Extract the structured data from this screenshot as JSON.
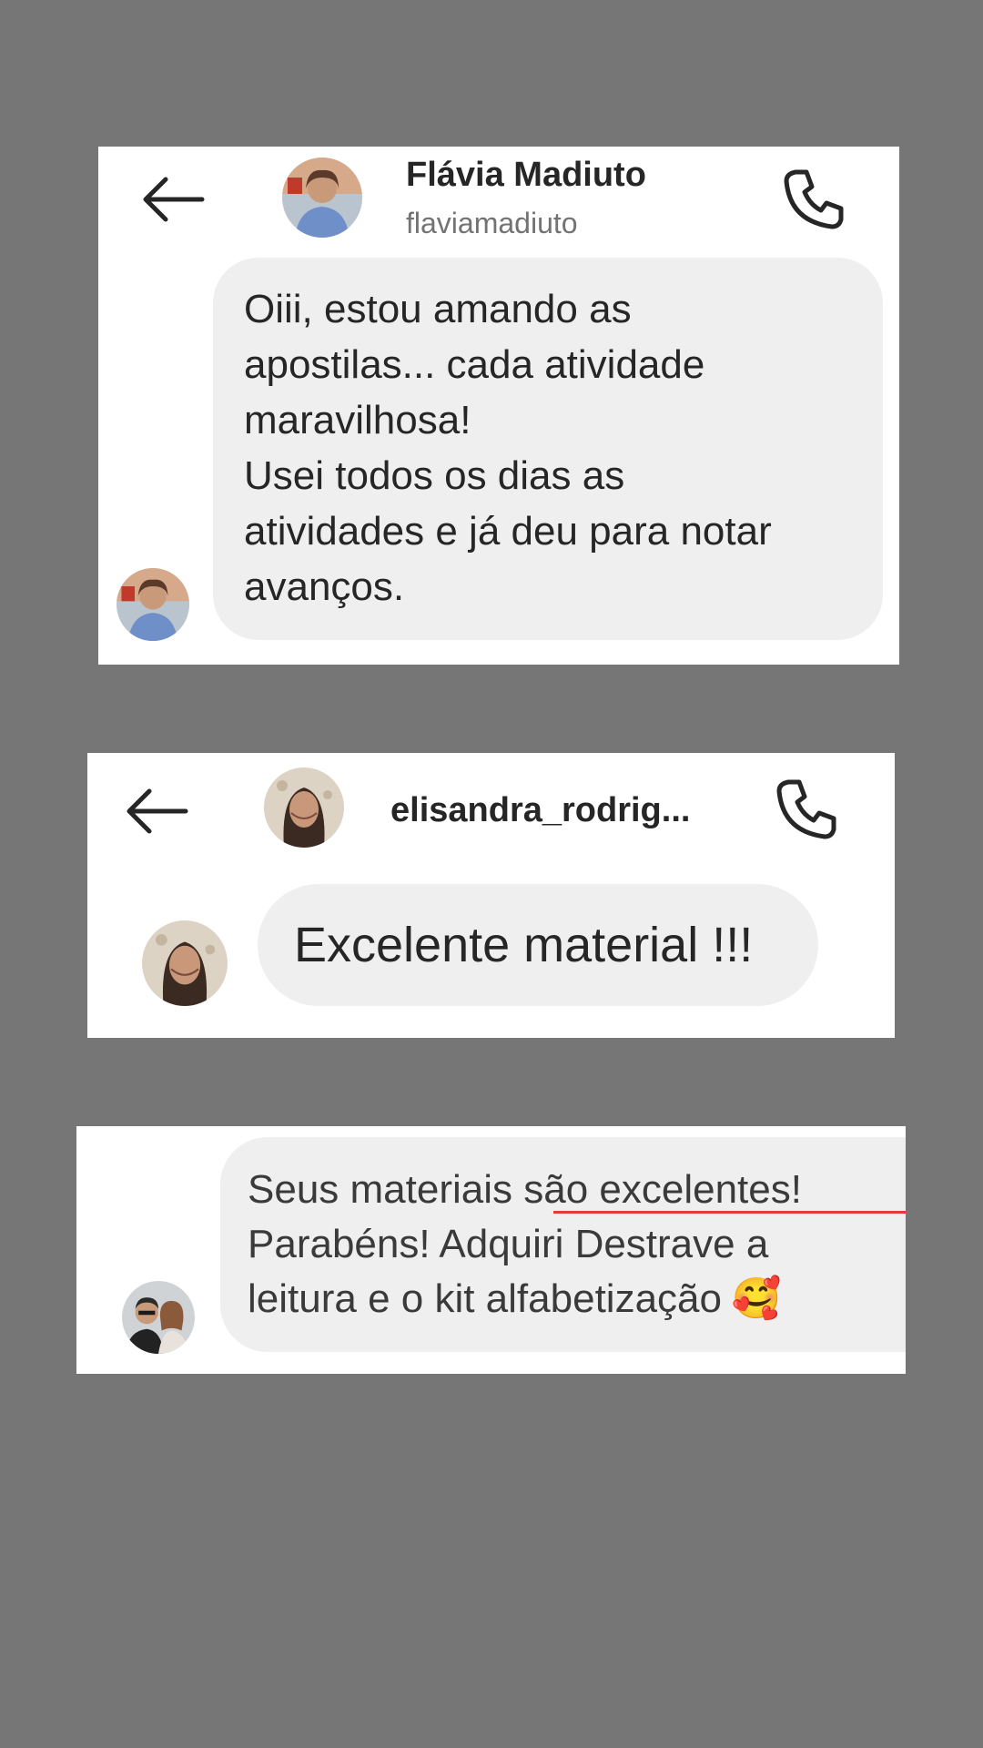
{
  "conversations": [
    {
      "contact_name": "Flávia Madiuto",
      "contact_handle": "flaviamadiuto",
      "message": "Oiii, estou amando as\napostilas... cada atividade\nmaravilhosa!\nUsei todos os dias as\natividades e já  deu para notar\navanços."
    },
    {
      "contact_name": "elisandra_rodrig...",
      "message": "Excelente material !!!"
    },
    {
      "message": "Seus materiais são excelentes!\nParabéns! Adquiri Destrave a\nleitura e o kit alfabetização",
      "emoji": "🥰"
    }
  ],
  "icons": {
    "back": "back-arrow-icon",
    "call": "phone-icon"
  },
  "colors": {
    "background": "#767676",
    "bubble": "#efefef",
    "highlight_underline": "#e8363f"
  }
}
